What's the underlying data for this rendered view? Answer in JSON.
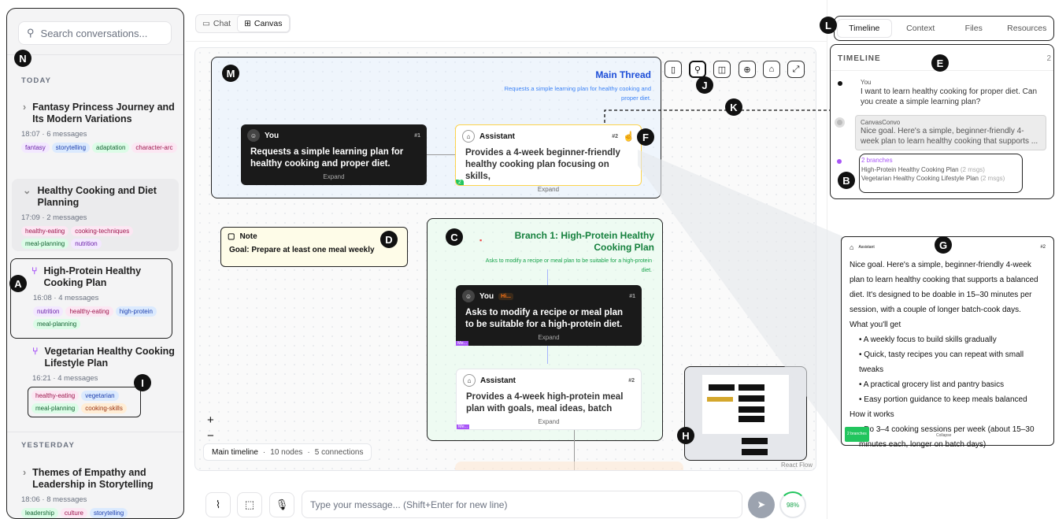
{
  "sidebar": {
    "search_placeholder": "Search conversations...",
    "today": "TODAY",
    "yesterday": "YESTERDAY",
    "convs": [
      {
        "title": "Fantasy Princess Journey and Its Modern Variations",
        "meta": "18:07 · 6 messages",
        "tags": [
          "fantasy",
          "storytelling",
          "adaptation",
          "character-arc"
        ]
      },
      {
        "title": "Healthy Cooking and Diet Planning",
        "meta": "17:09 · 2 messages",
        "tags": [
          "healthy-eating",
          "cooking-techniques",
          "meal-planning",
          "nutrition"
        ]
      },
      {
        "title": "High-Protein Healthy Cooking Plan",
        "meta": "16:08 · 4 messages",
        "tags": [
          "nutrition",
          "healthy-eating",
          "high-protein",
          "meal-planning"
        ]
      },
      {
        "title": "Vegetarian Healthy Cooking Lifestyle Plan",
        "meta": "16:21 · 4 messages",
        "tags": [
          "healthy-eating",
          "vegetarian",
          "meal-planning",
          "cooking-skills"
        ]
      },
      {
        "title": "Themes of Empathy and Leadership in Storytelling",
        "meta": "18:06 · 8 messages",
        "tags": [
          "leadership",
          "culture",
          "storytelling"
        ]
      }
    ]
  },
  "view_tabs": {
    "chat": "Chat",
    "canvas": "Canvas"
  },
  "canvas": {
    "main": {
      "title": "Main Thread",
      "subtitle": "Requests a simple learning plan for healthy cooking and proper diet."
    },
    "you_card": {
      "role": "You",
      "num": "#1",
      "text": "Requests a simple learning plan for healthy cooking and proper diet.",
      "expand": "Expand"
    },
    "asst_card": {
      "role": "Assistant",
      "num": "#2",
      "text": "Provides a 4-week beginner-friendly healthy cooking plan focusing on skills,",
      "expand": "Expand",
      "branch_badge": "2"
    },
    "note": {
      "label": "Note",
      "text": "Goal: Prepare at least one meal weekly"
    },
    "branch": {
      "title": "Branch 1: High-Protein Healthy Cooking Plan",
      "subtitle": "Asks to modify a recipe or meal plan to be suitable for a high-protein diet."
    },
    "b_you": {
      "role": "You",
      "chip": "Hi...",
      "num": "#1",
      "text": "Asks to modify a recipe or meal plan to be suitable for a high-protein diet.",
      "expand": "Expand",
      "tag": "Me..."
    },
    "b_asst": {
      "role": "Assistant",
      "num": "#2",
      "text": "Provides a 4-week high-protein meal plan with goals, meal ideas, batch",
      "expand": "Expand",
      "tag": "Me..."
    },
    "status": {
      "label": "Main timeline",
      "nodes": "10 nodes",
      "connections": "5 connections"
    },
    "attribution": "React Flow"
  },
  "right_tabs": [
    "Timeline",
    "Context",
    "Files",
    "Resources"
  ],
  "timeline": {
    "heading": "TIMELINE",
    "count": "2",
    "you": "You",
    "you_text": "I want to learn healthy cooking for proper diet. Can you create a simple learning plan?",
    "canvas": "CanvasConvo",
    "canvas_text": "Nice goal. Here's a simple, beginner-friendly 4-week plan to learn healthy cooking that supports ...",
    "branches": "2 branches",
    "b1": "High-Protein Healthy Cooking Plan",
    "b1c": "(2 msgs)",
    "b2": "Vegetarian Healthy Cooking Lifestyle Plan",
    "b2c": "(2 msgs)"
  },
  "popup": {
    "role": "Assistant",
    "num": "#2",
    "intro": "Nice goal. Here's a simple, beginner-friendly 4-week plan to learn healthy cooking that supports a balanced diet. It's designed to be doable in 15–30 minutes per session, with a couple of longer batch-cook days.",
    "h1": "What you'll get",
    "items1": [
      "A weekly focus to build skills gradually",
      "Quick, tasty recipes you can repeat with small tweaks",
      "A practical grocery list and pantry basics",
      "Easy portion guidance to keep meals balanced"
    ],
    "h2": "How it works",
    "items2": [
      "Do 3–4 cooking sessions per week (about 15–30 minutes each, longer on batch days)"
    ],
    "collapse": "Collapse",
    "foot_tag": "2 branches"
  },
  "input": {
    "placeholder": "Type your message... (Shift+Enter for new line)",
    "progress": "98%"
  },
  "badges": {
    "A": "A",
    "B": "B",
    "C": "C",
    "D": "D",
    "E": "E",
    "F": "F",
    "G": "G",
    "H": "H",
    "I": "I",
    "J": "J",
    "K": "K",
    "L": "L",
    "M": "M",
    "N": "N"
  }
}
